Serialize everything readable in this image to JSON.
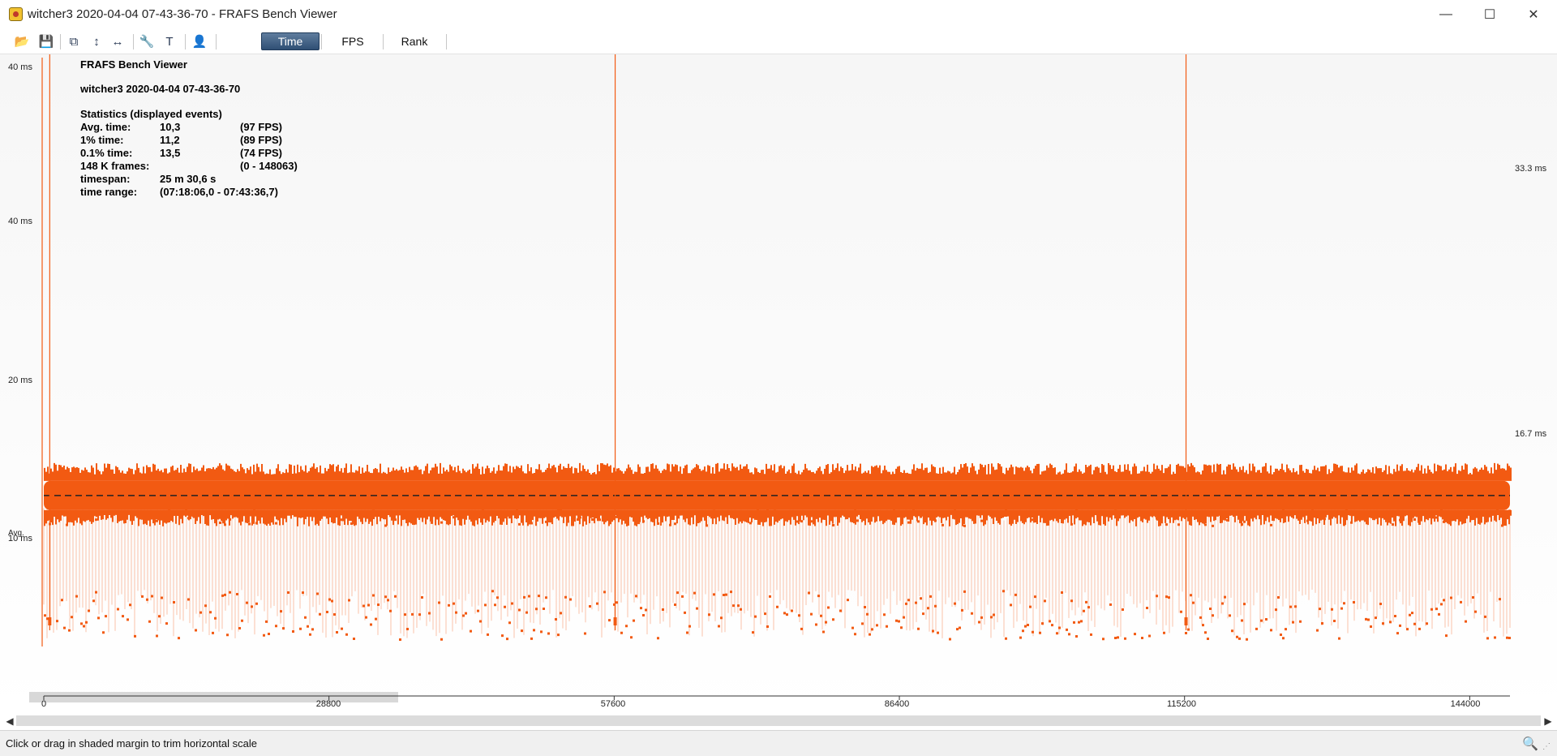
{
  "window": {
    "title": "witcher3 2020-04-04 07-43-36-70 - FRAFS Bench Viewer",
    "minimize_glyph": "—",
    "maximize_glyph": "☐",
    "close_glyph": "✕"
  },
  "toolbar": {
    "icons": [
      "open-folder-icon",
      "save-icon",
      "copy-icon",
      "fit-vertical-icon",
      "fit-horizontal-icon",
      "wrench-icon",
      "text-icon",
      "user-icon"
    ],
    "icon_glyphs": [
      "📂",
      "💾",
      "⧉",
      "↕",
      "↔",
      "🔧",
      "T",
      "👤"
    ],
    "tabs": [
      {
        "label": "Time",
        "active": true
      },
      {
        "label": "FPS",
        "active": false
      },
      {
        "label": "Rank",
        "active": false
      }
    ]
  },
  "stats": {
    "app_name": "FRAFS Bench Viewer",
    "session": "witcher3 2020-04-04 07-43-36-70",
    "heading": "Statistics (displayed events)",
    "rows": [
      {
        "label": "Avg. time:",
        "value": "10,3",
        "extra": "(97 FPS)"
      },
      {
        "label": "1% time:",
        "value": "11,2",
        "extra": "(89 FPS)"
      },
      {
        "label": "0.1% time:",
        "value": "13,5",
        "extra": "(74 FPS)"
      },
      {
        "label": "148 K frames:",
        "value": "",
        "extra": "(0 - 148063)"
      },
      {
        "label": "timespan:",
        "value": "25 m 30,6 s",
        "extra": ""
      },
      {
        "label": "time range:",
        "value": "(07:18:06,0 - 07:43:36,7)",
        "extra": ""
      }
    ]
  },
  "axis": {
    "y_labels": [
      "40 ms",
      "40 ms",
      "20 ms",
      "10 ms"
    ],
    "avg_label": "Avg.",
    "ref_lines": [
      "33.3 ms",
      "16.7 ms"
    ]
  },
  "chart_data": {
    "type": "scatter",
    "title": "",
    "xlabel": "",
    "ylabel": "",
    "x_ticks": [
      0,
      28800,
      57600,
      86400,
      115200,
      144000
    ],
    "xlim": [
      0,
      148063
    ],
    "y_ticks_ms": [
      10,
      20,
      40,
      40
    ],
    "y_scale": "reciprocal",
    "reference_lines_ms": [
      33.3,
      16.7
    ],
    "average_ms": 10.3,
    "series": [
      {
        "color": "#f25a12",
        "band_center_ms": 10.3,
        "spike_frames": [
          600,
          57700,
          115350
        ],
        "spike_value_ms": 40
      }
    ],
    "grid": false,
    "legend": "none"
  },
  "colors": {
    "series": "#f25a12",
    "series_light": "#f7a07a"
  },
  "status": {
    "text": "Click or drag in shaded margin to trim horizontal scale"
  }
}
